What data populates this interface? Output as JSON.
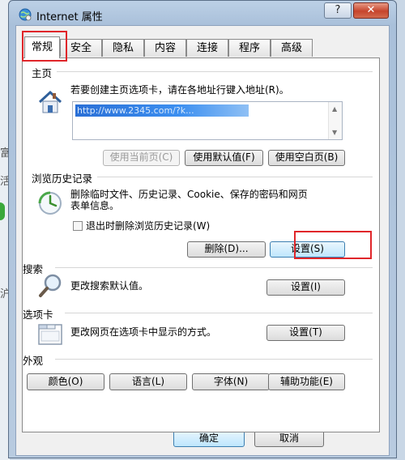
{
  "window": {
    "title": "Internet 属性",
    "help_label": "?",
    "close_label": "✕"
  },
  "tabs": [
    {
      "label": "常规",
      "active": true
    },
    {
      "label": "安全"
    },
    {
      "label": "隐私"
    },
    {
      "label": "内容"
    },
    {
      "label": "连接"
    },
    {
      "label": "程序"
    },
    {
      "label": "高级"
    }
  ],
  "homepage": {
    "section_title": "主页",
    "description": "若要创建主页选项卡，请在各地址行键入地址(R)。",
    "url_value": "http://www.2345.com/?k...",
    "use_current_label": "使用当前页(C)",
    "use_default_label": "使用默认值(F)",
    "use_blank_label": "使用空白页(B)"
  },
  "history": {
    "section_title": "浏览历史记录",
    "description_line1": "删除临时文件、历史记录、Cookie、保存的密码和网页",
    "description_line2": "表单信息。",
    "checkbox_label": "退出时删除浏览历史记录(W)",
    "delete_label": "删除(D)...",
    "settings_label": "设置(S)"
  },
  "search": {
    "section_title": "搜索",
    "description": "更改搜索默认值。",
    "settings_label": "设置(I)"
  },
  "tabs_section": {
    "section_title": "选项卡",
    "description": "更改网页在选项卡中显示的方式。",
    "settings_label": "设置(T)"
  },
  "appearance": {
    "section_title": "外观",
    "colors_label": "颜色(O)",
    "languages_label": "语言(L)",
    "fonts_label": "字体(N)",
    "accessibility_label": "辅助功能(E)"
  },
  "footer": {
    "ok_label": "确定",
    "cancel_label": "取消"
  },
  "background": {
    "char1": "富",
    "char2": "活",
    "char3": "沪"
  }
}
